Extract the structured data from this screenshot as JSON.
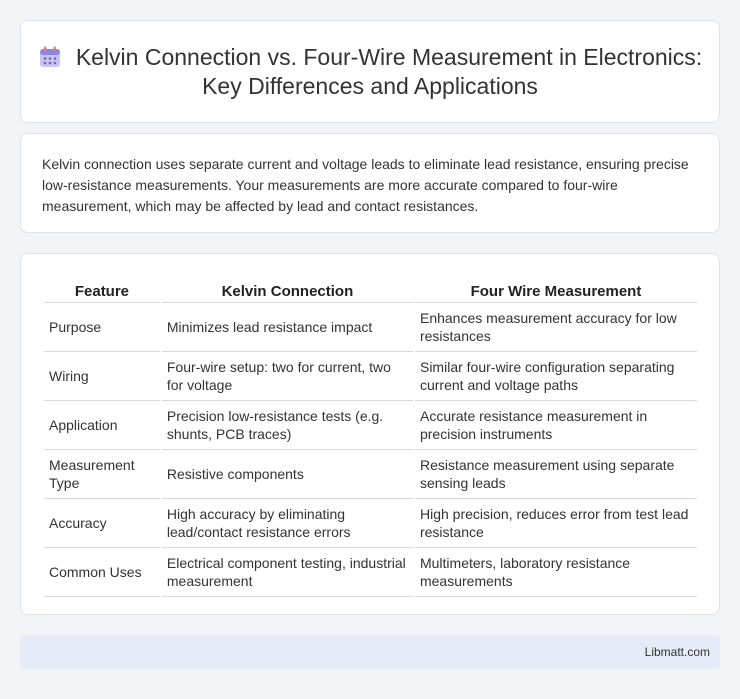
{
  "header": {
    "title": "Kelvin Connection vs. Four-Wire Measurement in Electronics: Key Differences and Applications",
    "icon": "calendar-icon"
  },
  "intro": {
    "text": "Kelvin connection uses separate current and voltage leads to eliminate lead resistance, ensuring precise low-resistance measurements. Your measurements are more accurate compared to four-wire measurement, which may be affected by lead and contact resistances."
  },
  "table": {
    "headers": [
      "Feature",
      "Kelvin Connection",
      "Four Wire Measurement"
    ],
    "rows": [
      [
        "Purpose",
        "Minimizes lead resistance impact",
        "Enhances measurement accuracy for low resistances"
      ],
      [
        "Wiring",
        "Four-wire setup: two for current, two for voltage",
        "Similar four-wire configuration separating current and voltage paths"
      ],
      [
        "Application",
        "Precision low-resistance tests (e.g. shunts, PCB traces)",
        "Accurate resistance measurement in precision instruments"
      ],
      [
        "Measurement Type",
        "Resistive components",
        "Resistance measurement using separate sensing leads"
      ],
      [
        "Accuracy",
        "High accuracy by eliminating lead/contact resistance errors",
        "High precision, reduces error from test lead resistance"
      ],
      [
        "Common Uses",
        "Electrical component testing, industrial measurement",
        "Multimeters, laboratory resistance measurements"
      ]
    ]
  },
  "footer": {
    "text": "Libmatt.com"
  }
}
